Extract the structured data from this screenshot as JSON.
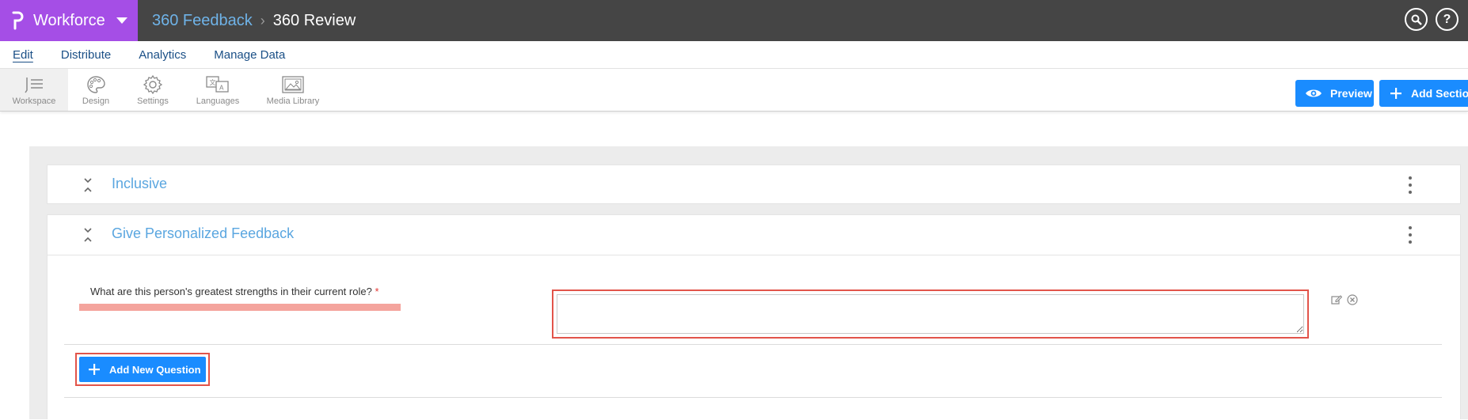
{
  "app": {
    "name": "Workforce",
    "breadcrumb": {
      "parent": "360 Feedback",
      "current": "360 Review"
    }
  },
  "menu": {
    "items": [
      {
        "label": "Edit",
        "active": true
      },
      {
        "label": "Distribute"
      },
      {
        "label": "Analytics"
      },
      {
        "label": "Manage Data"
      }
    ]
  },
  "toolbar": {
    "tools": [
      {
        "label": "Workspace",
        "icon": "workspace-icon",
        "active": true
      },
      {
        "label": "Design",
        "icon": "palette-icon"
      },
      {
        "label": "Settings",
        "icon": "gear-icon"
      },
      {
        "label": "Languages",
        "icon": "translate-icon"
      },
      {
        "label": "Media Library",
        "icon": "image-icon"
      }
    ],
    "preview_label": "Preview",
    "add_section_label": "Add Section"
  },
  "sections": [
    {
      "title": "Inclusive"
    },
    {
      "title": "Give Personalized Feedback",
      "question": {
        "text": "What are this person's greatest strengths in their current role?",
        "required_mark": "*",
        "answer": ""
      },
      "add_question_label": "Add New Question"
    }
  ],
  "colors": {
    "brand": "#a54ee6",
    "topbar": "#454545",
    "accent": "#1a8cff",
    "section_title": "#5aa6e0",
    "highlight": "#e2544a"
  }
}
